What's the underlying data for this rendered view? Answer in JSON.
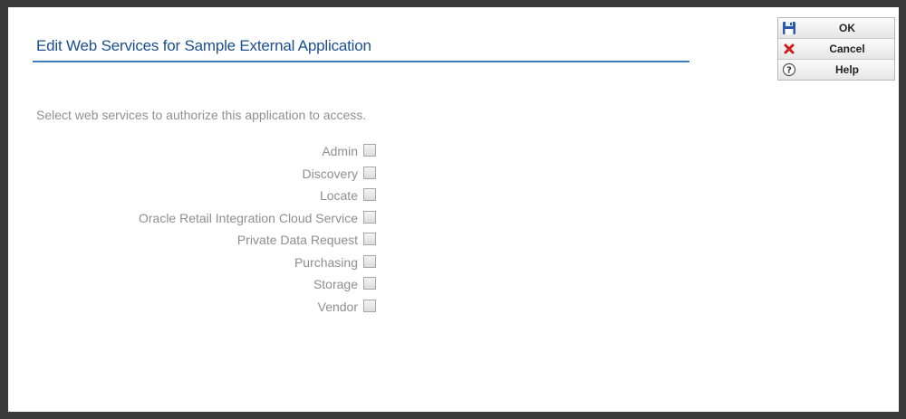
{
  "dialog": {
    "title": "Edit Web Services for Sample External Application",
    "instructions": "Select web services to authorize this application to access."
  },
  "services": [
    {
      "label": "Admin",
      "checked": false
    },
    {
      "label": "Discovery",
      "checked": false
    },
    {
      "label": "Locate",
      "checked": false
    },
    {
      "label": "Oracle Retail Integration Cloud Service",
      "checked": false
    },
    {
      "label": "Private Data Request",
      "checked": false
    },
    {
      "label": "Purchasing",
      "checked": false
    },
    {
      "label": "Storage",
      "checked": false
    },
    {
      "label": "Vendor",
      "checked": false
    }
  ],
  "buttons": {
    "ok": {
      "label": "OK",
      "icon": "save-icon"
    },
    "cancel": {
      "label": "Cancel",
      "icon": "cancel-icon"
    },
    "help": {
      "label": "Help",
      "icon": "help-icon"
    }
  },
  "colors": {
    "title": "#1a4f8f",
    "title_rule": "#3e7cc2",
    "label": "#8e8e8e",
    "cancel_icon": "#cc2020",
    "save_icon": "#2a5aa8"
  }
}
